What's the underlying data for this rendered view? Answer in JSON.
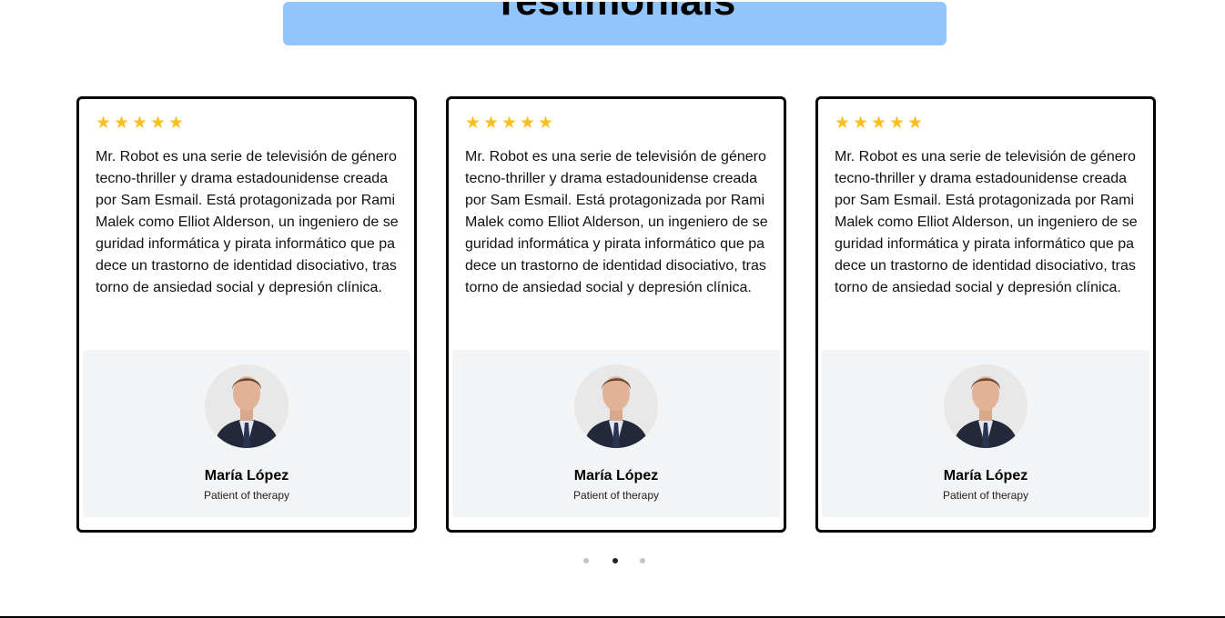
{
  "header": {
    "title": "Testimonials"
  },
  "colors": {
    "banner": "#93c5fd",
    "star": "#fbbf24",
    "profile_bg": "#f3f4f6",
    "border": "#000000"
  },
  "testimonials": [
    {
      "rating": 5,
      "quote": "Mr. Robot es una serie de televisión de género tecno-thriller y drama estadounidense creada por Sam Esmail. Está protagonizada por Rami Malek como Elliot Alderson, un ingeniero de seguridad informática y pirata informático que padece un trastorno de identidad disociativo, trastorno de ansiedad social y depresión clínica.",
      "name": "María López",
      "role": "Patient of therapy",
      "avatar_icon": "person-photo-icon"
    },
    {
      "rating": 5,
      "quote": "Mr. Robot es una serie de televisión de género tecno-thriller y drama estadounidense creada por Sam Esmail. Está protagonizada por Rami Malek como Elliot Alderson, un ingeniero de seguridad informática y pirata informático que padece un trastorno de identidad disociativo, trastorno de ansiedad social y depresión clínica.",
      "name": "María López",
      "role": "Patient of therapy",
      "avatar_icon": "person-photo-icon"
    },
    {
      "rating": 5,
      "quote": "Mr. Robot es una serie de televisión de género tecno-thriller y drama estadounidense creada por Sam Esmail. Está protagonizada por Rami Malek como Elliot Alderson, un ingeniero de seguridad informática y pirata informático que padece un trastorno de identidad disociativo, trastorno de ansiedad social y depresión clínica.",
      "name": "María López",
      "role": "Patient of therapy",
      "avatar_icon": "person-photo-icon"
    }
  ],
  "carousel": {
    "pages": 3,
    "active_page": 2
  }
}
